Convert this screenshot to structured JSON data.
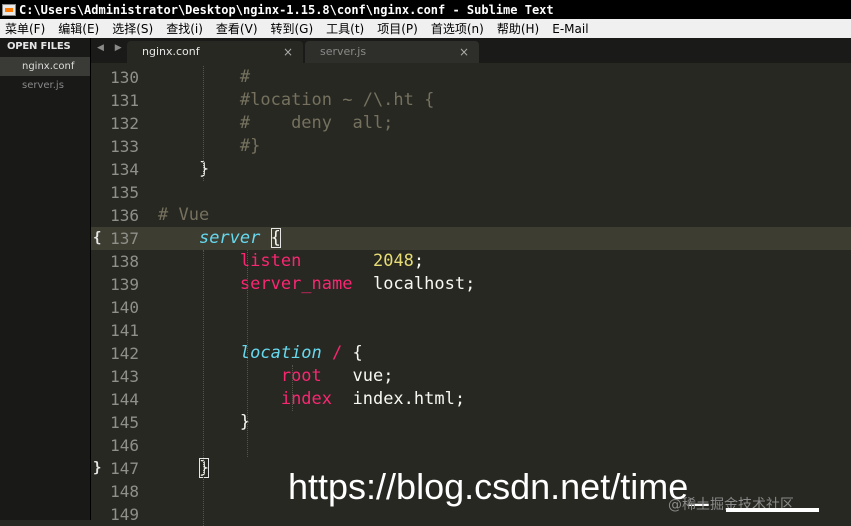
{
  "window": {
    "title": "C:\\Users\\Administrator\\Desktop\\nginx-1.15.8\\conf\\nginx.conf - Sublime Text"
  },
  "menu": [
    "菜单(F)",
    "编辑(E)",
    "选择(S)",
    "查找(i)",
    "查看(V)",
    "转到(G)",
    "工具(t)",
    "项目(P)",
    "首选项(n)",
    "帮助(H)",
    "E-Mail"
  ],
  "sidebar": {
    "header": "OPEN FILES",
    "files": [
      {
        "name": "nginx.conf",
        "active": true
      },
      {
        "name": "server.js",
        "active": false
      }
    ]
  },
  "tabs": [
    {
      "name": "nginx.conf",
      "active": true,
      "close": "×"
    },
    {
      "name": "server.js",
      "active": false,
      "close": "×"
    }
  ],
  "nav_arrows": "◀ ▶",
  "editor": {
    "lines": [
      {
        "n": "130",
        "text": "        #"
      },
      {
        "n": "131",
        "text": "        #location ~ /\\.ht {"
      },
      {
        "n": "132",
        "text": "        #    deny  all;"
      },
      {
        "n": "133",
        "text": "        #}"
      },
      {
        "n": "134",
        "text": "    }"
      },
      {
        "n": "135",
        "text": ""
      },
      {
        "n": "136",
        "text": "# Vue"
      },
      {
        "n": "137",
        "text": "    server {"
      },
      {
        "n": "138",
        "text": "        listen       2048;"
      },
      {
        "n": "139",
        "text": "        server_name  localhost;"
      },
      {
        "n": "140",
        "text": ""
      },
      {
        "n": "141",
        "text": ""
      },
      {
        "n": "142",
        "text": "        location / {"
      },
      {
        "n": "143",
        "text": "            root   vue;"
      },
      {
        "n": "144",
        "text": "            index  index.html;"
      },
      {
        "n": "145",
        "text": "        }"
      },
      {
        "n": "146",
        "text": ""
      },
      {
        "n": "147",
        "text": "    }"
      },
      {
        "n": "148",
        "text": ""
      },
      {
        "n": "149",
        "text": ""
      }
    ],
    "gutter_marks": {
      "137": "{",
      "147": "}"
    }
  },
  "watermark": {
    "url": "https://blog.csdn.net/time_",
    "cn": "@稀土掘金技术社区"
  },
  "colors": {
    "background": "#272822",
    "comment": "#75715e",
    "keyword": "#66d9ef",
    "directive": "#f92672",
    "number": "#e6db74"
  }
}
